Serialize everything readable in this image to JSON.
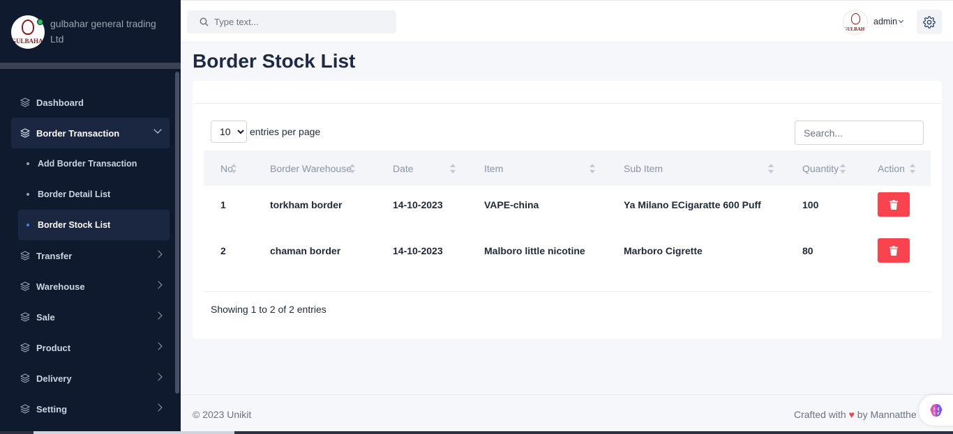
{
  "brand": {
    "logo_text": "GULBAHAR",
    "name": "gulbahar general trading Ltd"
  },
  "sidebar": {
    "items": [
      {
        "label": "Dashboard",
        "icon": "layers-icon"
      },
      {
        "label": "Border Transaction",
        "icon": "layers-icon",
        "expanded": true,
        "children": [
          {
            "label": "Add Border Transaction"
          },
          {
            "label": "Border Detail List"
          },
          {
            "label": "Border Stock List",
            "active": true
          }
        ]
      },
      {
        "label": "Transfer",
        "icon": "layers-icon"
      },
      {
        "label": "Warehouse",
        "icon": "layers-icon"
      },
      {
        "label": "Sale",
        "icon": "layers-icon"
      },
      {
        "label": "Product",
        "icon": "layers-icon"
      },
      {
        "label": "Delivery",
        "icon": "layers-icon"
      },
      {
        "label": "Setting",
        "icon": "layers-icon"
      }
    ]
  },
  "topbar": {
    "search_placeholder": "Type text...",
    "user_name": "admin",
    "avatar_text": "GULBAHAR"
  },
  "page": {
    "title": "Border Stock List"
  },
  "table_controls": {
    "entries_value": "10",
    "entries_label": "entries per page",
    "search_placeholder": "Search..."
  },
  "table": {
    "columns": [
      "No",
      "Border Warehouse",
      "Date",
      "Item",
      "Sub Item",
      "Quantity",
      "Action"
    ],
    "rows": [
      {
        "no": "1",
        "warehouse": "torkham border",
        "date": "14-10-2023",
        "item": "VAPE-china",
        "sub_item": "Ya Milano ECigaratte 600 Puff",
        "quantity": "100"
      },
      {
        "no": "2",
        "warehouse": "chaman border",
        "date": "14-10-2023",
        "item": "Malboro little nicotine",
        "sub_item": "Marboro Cigrette",
        "quantity": "80"
      }
    ],
    "showing": "Showing 1 to 2 of 2 entries"
  },
  "footer": {
    "copyright": "© 2023 Unikit",
    "crafted_prefix": "Crafted with",
    "crafted_suffix": "by Mannatthe"
  },
  "colors": {
    "sidebar_bg": "#0f1a2e",
    "danger": "#f9434f",
    "active_bullet": "#3b82f6"
  }
}
